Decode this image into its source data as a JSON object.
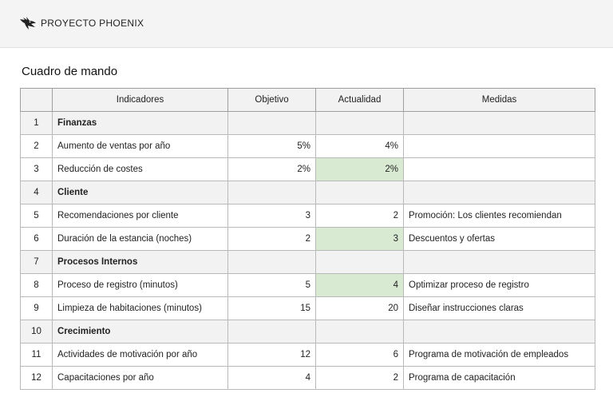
{
  "header": {
    "brand_icon": "phoenix-logo-icon",
    "brand": "PROYECTO PHOENIX"
  },
  "page_title": "Cuadro de mando",
  "table": {
    "columns": [
      "",
      "Indicadores",
      "Objetivo",
      "Actualidad",
      "Medidas"
    ],
    "highlight_color": "#d9ead3",
    "rows": [
      {
        "n": "1",
        "indicator": "Finanzas",
        "target": "",
        "current": "",
        "measure": "",
        "category": true
      },
      {
        "n": "2",
        "indicator": "Aumento de ventas por año",
        "target": "5%",
        "current": "4%",
        "measure": ""
      },
      {
        "n": "3",
        "indicator": "Reducción de costes",
        "target": "2%",
        "current": "2%",
        "measure": "",
        "highlight": true
      },
      {
        "n": "4",
        "indicator": "Cliente",
        "target": "",
        "current": "",
        "measure": "",
        "category": true
      },
      {
        "n": "5",
        "indicator": "Recomendaciones por cliente",
        "target": "3",
        "current": "2",
        "measure": "Promoción: Los clientes recomiendan"
      },
      {
        "n": "6",
        "indicator": "Duración de la estancia (noches)",
        "target": "2",
        "current": "3",
        "measure": "Descuentos y ofertas",
        "highlight": true
      },
      {
        "n": "7",
        "indicator": "Procesos Internos",
        "target": "",
        "current": "",
        "measure": "",
        "category": true
      },
      {
        "n": "8",
        "indicator": "Proceso de registro (minutos)",
        "target": "5",
        "current": "4",
        "measure": "Optimizar proceso de registro",
        "highlight": true
      },
      {
        "n": "9",
        "indicator": "Limpieza de habitaciones (minutos)",
        "target": "15",
        "current": "20",
        "measure": "Diseñar instrucciones claras"
      },
      {
        "n": "10",
        "indicator": "Crecimiento",
        "target": "",
        "current": "",
        "measure": "",
        "category": true
      },
      {
        "n": "11",
        "indicator": "Actividades de motivación por año",
        "target": "12",
        "current": "6",
        "measure": "Programa de motivación de empleados"
      },
      {
        "n": "12",
        "indicator": "Capacitaciones por año",
        "target": "4",
        "current": "2",
        "measure": "Programa de capacitación"
      }
    ]
  }
}
